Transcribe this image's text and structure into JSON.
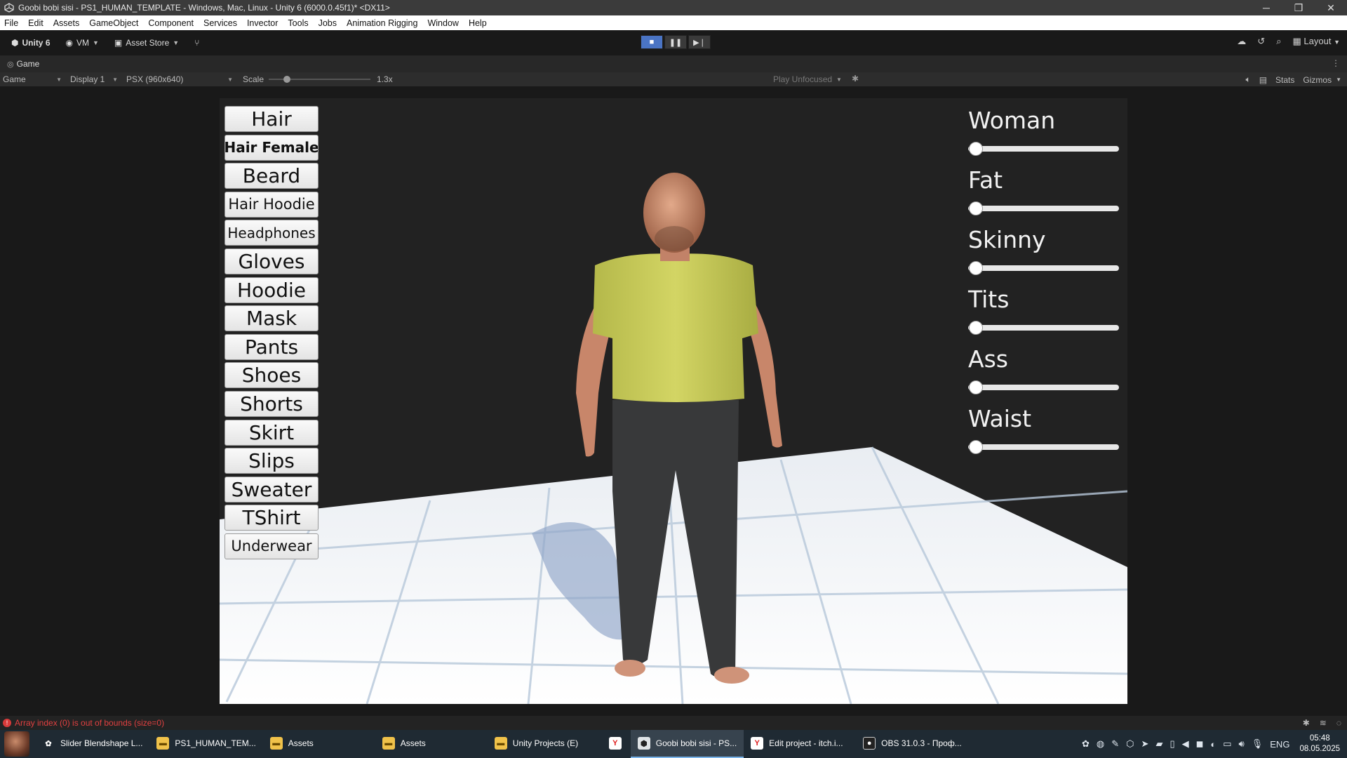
{
  "window": {
    "title": "Goobi bobi sisi - PS1_HUMAN_TEMPLATE - Windows, Mac, Linux - Unity 6 (6000.0.45f1)* <DX11>",
    "minimize": "─",
    "restore": "❐",
    "close": "✕"
  },
  "menu": [
    "File",
    "Edit",
    "Assets",
    "GameObject",
    "Component",
    "Services",
    "Invector",
    "Tools",
    "Jobs",
    "Animation Rigging",
    "Window",
    "Help"
  ],
  "toolbar": {
    "unity_label": "Unity 6",
    "account_label": "VM",
    "asset_store_label": "Asset Store",
    "layout_label": "Layout"
  },
  "tab": {
    "game_label": "Game"
  },
  "gamebar": {
    "view_mode": "Game",
    "display": "Display 1",
    "resolution": "PSX (960x640)",
    "scale_label": "Scale",
    "scale_value": "1.3x",
    "scale_fraction": 0.15,
    "play_mode": "Play Unfocused",
    "stats_label": "Stats",
    "gizmos_label": "Gizmos"
  },
  "buttons": [
    {
      "label": "Hair"
    },
    {
      "label": "Hair Female"
    },
    {
      "label": "Beard"
    },
    {
      "label": "Hair Hoodie"
    },
    {
      "label": "Headphones"
    },
    {
      "label": "Gloves"
    },
    {
      "label": "Hoodie"
    },
    {
      "label": "Mask"
    },
    {
      "label": "Pants"
    },
    {
      "label": "Shoes"
    },
    {
      "label": "Shorts"
    },
    {
      "label": "Skirt"
    },
    {
      "label": "Slips"
    },
    {
      "label": "Sweater"
    },
    {
      "label": "TShirt"
    },
    {
      "label": "Underwear"
    }
  ],
  "sliders": [
    {
      "label": "Woman",
      "value": 0
    },
    {
      "label": "Fat",
      "value": 0
    },
    {
      "label": "Skinny",
      "value": 0
    },
    {
      "label": "Tits",
      "value": 0
    },
    {
      "label": "Ass",
      "value": 0
    },
    {
      "label": "Waist",
      "value": 0
    }
  ],
  "console": {
    "message": "Array index (0) is out of bounds (size=0)"
  },
  "taskbar": {
    "items": [
      {
        "label": "Slider Blendshape L...",
        "icon": "chatgpt-icon"
      },
      {
        "label": "PS1_HUMAN_TEM...",
        "icon": "folder-icon"
      },
      {
        "label": "Assets",
        "icon": "folder-icon"
      },
      {
        "label": "Assets",
        "icon": "folder-icon"
      },
      {
        "label": "Unity Projects (E)",
        "icon": "folder-icon"
      },
      {
        "label": "",
        "icon": "yandex-icon"
      },
      {
        "label": "Goobi bobi sisi - PS...",
        "icon": "unity-icon"
      },
      {
        "label": "Edit project - itch.i...",
        "icon": "yandex-icon"
      },
      {
        "label": "OBS 31.0.3 - Проф...",
        "icon": "obs-icon"
      }
    ],
    "language": "ENG",
    "time": "05:48",
    "date": "08.05.2025"
  },
  "colors": {
    "tshirt": "#c8c95a",
    "pants": "#3a3c3b",
    "skin": "#c98a6a",
    "floor": "#f4f6f8",
    "accent": "#4a74c4"
  }
}
